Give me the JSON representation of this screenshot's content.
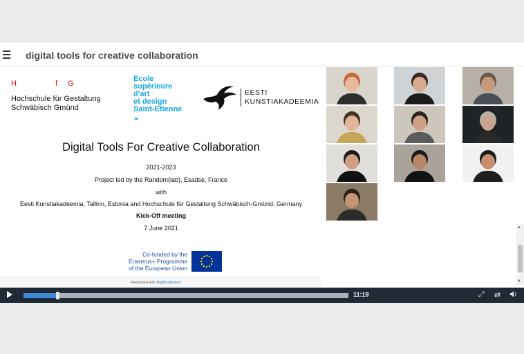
{
  "app": {
    "title": "digital tools for creative collaboration",
    "menu_icon": "menu-icon"
  },
  "slide": {
    "hfg_letters": [
      "H",
      "f",
      "G"
    ],
    "hfg_name_line1": "Hochschule für Gestaltung",
    "hfg_name_line2": "Schwäbisch Gmünd",
    "esade_lines": [
      "Ecole",
      "supérieure",
      "d'art",
      "et design",
      "Saint-Etienne"
    ],
    "eka_lines": [
      "EESTI",
      "KUNSTIAKADEEMIA"
    ],
    "title": "Digital Tools For Creative Collaboration",
    "years": "2021-2023",
    "led_by": "Project led by the Random(lab), Esadse, France",
    "with": "with",
    "partners": "Eesti Kunstiakadeemia, Tallinn, Estonia and Hochschule für Gestaltung Schwäbisch-Gmünd, Germany",
    "event": "Kick-Off meeting",
    "date": "7 June 2021",
    "eu_lines": [
      "Co-funded by the",
      "Erasmus+ Programme",
      "of the European Union"
    ],
    "recorded_prefix": "Recorded with ",
    "recorded_brand": "BigBlueButton"
  },
  "webcams": [
    {
      "bg": "#d9d4cc",
      "skin": "#e8b9a0",
      "hair": "#c46a3a",
      "shirt": "#2e2e2e"
    },
    {
      "bg": "#cfd3d6",
      "skin": "#d7a98e",
      "hair": "#3a2a22",
      "shirt": "#1c1c1c"
    },
    {
      "bg": "#b7b0a6",
      "skin": "#c49a7a",
      "hair": "#6b5a4a",
      "shirt": "#4a4e5a"
    },
    {
      "bg": "#dcd7cc",
      "skin": "#e3b49a",
      "hair": "#4a3426",
      "shirt": "#c6a65a"
    },
    {
      "bg": "#ccc6bc",
      "skin": "#cfa184",
      "hair": "#2d2520",
      "shirt": "#5c5c5c"
    },
    {
      "bg": "#202326",
      "skin": "#c9a48e",
      "hair": "#b7b2a8",
      "shirt": "#2a2a2a"
    },
    {
      "bg": "#e1dfdb",
      "skin": "#d19d82",
      "hair": "#1e1a18",
      "shirt": "#111111"
    },
    {
      "bg": "#a9a39a",
      "skin": "#b98567",
      "hair": "#1a1a1a",
      "shirt": "#121212"
    },
    {
      "bg": "#f1f1f0",
      "skin": "#c88f6e",
      "hair": "#1b1b1b",
      "shirt": "#1f1f1f"
    },
    {
      "bg": "#8a7a66",
      "skin": "#c49474",
      "hair": "#2a211b",
      "shirt": "#2b2b2b"
    }
  ],
  "player": {
    "time": "11:19",
    "progress_fraction": 0.105,
    "icons": [
      "play-icon",
      "fullscreen-icon",
      "swap-icon",
      "volume-icon"
    ]
  },
  "colors": {
    "accent": "#3e8ad6",
    "controls_bg": "#1f2a36",
    "hfg_red": "#e30613",
    "esade_blue": "#17a9e1",
    "eu_blue": "#003399"
  }
}
